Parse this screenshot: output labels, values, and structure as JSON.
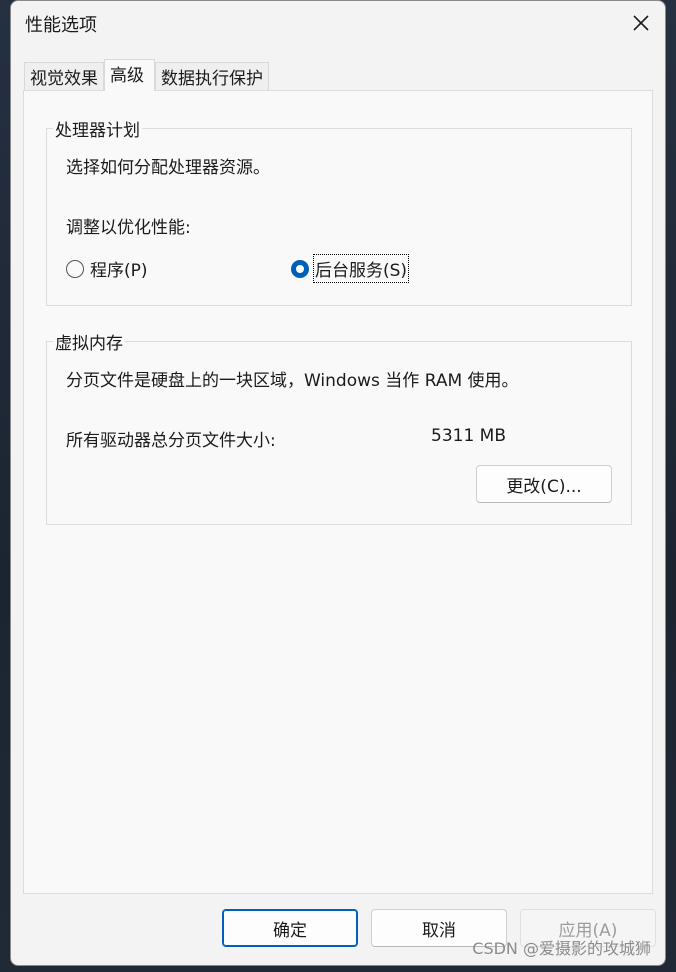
{
  "window": {
    "title": "性能选项"
  },
  "tabs": [
    {
      "label": "视觉效果"
    },
    {
      "label": "高级"
    },
    {
      "label": "数据执行保护"
    }
  ],
  "processor": {
    "title": "处理器计划",
    "description": "选择如何分配处理器资源。",
    "adjust_label": "调整以优化性能:",
    "options": [
      {
        "label": "程序(P)",
        "checked": false
      },
      {
        "label": "后台服务(S)",
        "checked": true
      }
    ]
  },
  "virtual_memory": {
    "title": "虚拟内存",
    "description": "分页文件是硬盘上的一块区域，Windows 当作 RAM 使用。",
    "total_label": "所有驱动器总分页文件大小:",
    "total_value": "5311 MB",
    "change_button": "更改(C)..."
  },
  "footer": {
    "ok": "确定",
    "cancel": "取消",
    "apply": "应用(A)"
  },
  "watermark": "CSDN @爱摄影的攻城狮",
  "colors": {
    "accent": "#005fb8"
  }
}
